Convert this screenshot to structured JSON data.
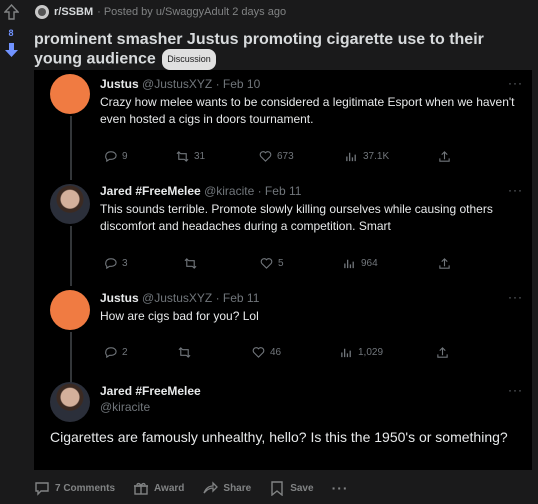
{
  "votes": {
    "count": "8"
  },
  "post": {
    "subreddit": "r/SSBM",
    "posted_by": "· Posted by u/SwaggyAdult 2 days ago",
    "title": "prominent smasher Justus promoting cigarette use to their young audience",
    "flair": "Discussion"
  },
  "tweets": [
    {
      "name": "Justus",
      "meta": "@JustusXYZ · Feb 10",
      "text": "Crazy how melee wants to be considered a legitimate Esport when we haven't even hosted a cigs in doors tournament.",
      "replies": "9",
      "retweets": "31",
      "likes": "673",
      "views": "37.1K"
    },
    {
      "name": "Jared #FreeMelee",
      "meta": "@kiracite · Feb 11",
      "text": "This sounds terrible. Promote slowly killing ourselves while causing others discomfort and headaches during a competition. Smart",
      "replies": "3",
      "retweets": "",
      "likes": "5",
      "views": "964"
    },
    {
      "name": "Justus",
      "meta": "@JustusXYZ · Feb 11",
      "text": "How are cigs bad for you? Lol",
      "replies": "2",
      "retweets": "",
      "likes": "46",
      "views": "1,029"
    },
    {
      "name": "Jared #FreeMelee",
      "handle": "@kiracite",
      "text": "Cigarettes are famously unhealthy, hello? Is this the 1950's or something?"
    }
  ],
  "more_label": "···",
  "footer": {
    "comments": "7 Comments",
    "award": "Award",
    "share": "Share",
    "save": "Save",
    "more": "···"
  },
  "colors": {
    "avatar_orange": "#f07b42",
    "upvote_blue": "#7193ff"
  }
}
